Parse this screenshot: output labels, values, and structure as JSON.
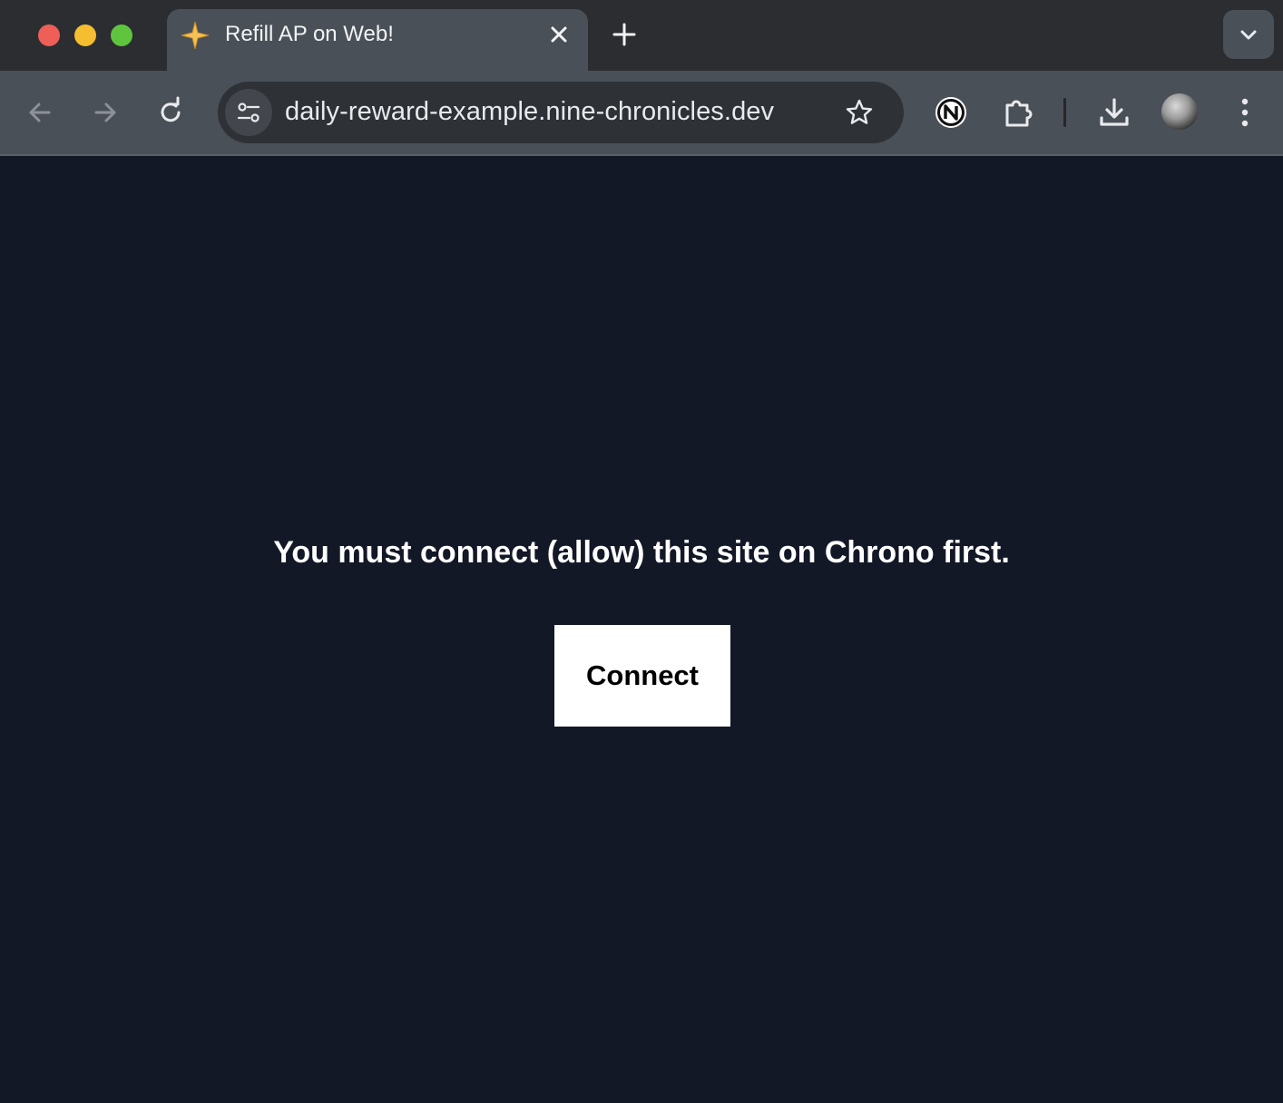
{
  "browser": {
    "tab": {
      "title": "Refill AP on Web!",
      "favicon": "sparkle-star-icon"
    },
    "url": "daily-reward-example.nine-chronicles.dev",
    "icons": {
      "back": "arrow-left-icon",
      "forward": "arrow-right-icon",
      "reload": "reload-icon",
      "site_info": "tune-icon",
      "bookmark": "star-icon",
      "extension_chrono": "nine-chronicles-n-icon",
      "extensions": "puzzle-icon",
      "downloads": "download-icon",
      "menu": "kebab-menu-icon",
      "new_tab": "plus-icon",
      "tab_search": "chevron-down-icon"
    },
    "colors": {
      "close": "#ee5f57",
      "minimize": "#f5bd30",
      "maximize": "#5fc53e"
    }
  },
  "page": {
    "message": "You must connect (allow) this site on Chrono first.",
    "connect_label": "Connect",
    "background": "#131827"
  }
}
